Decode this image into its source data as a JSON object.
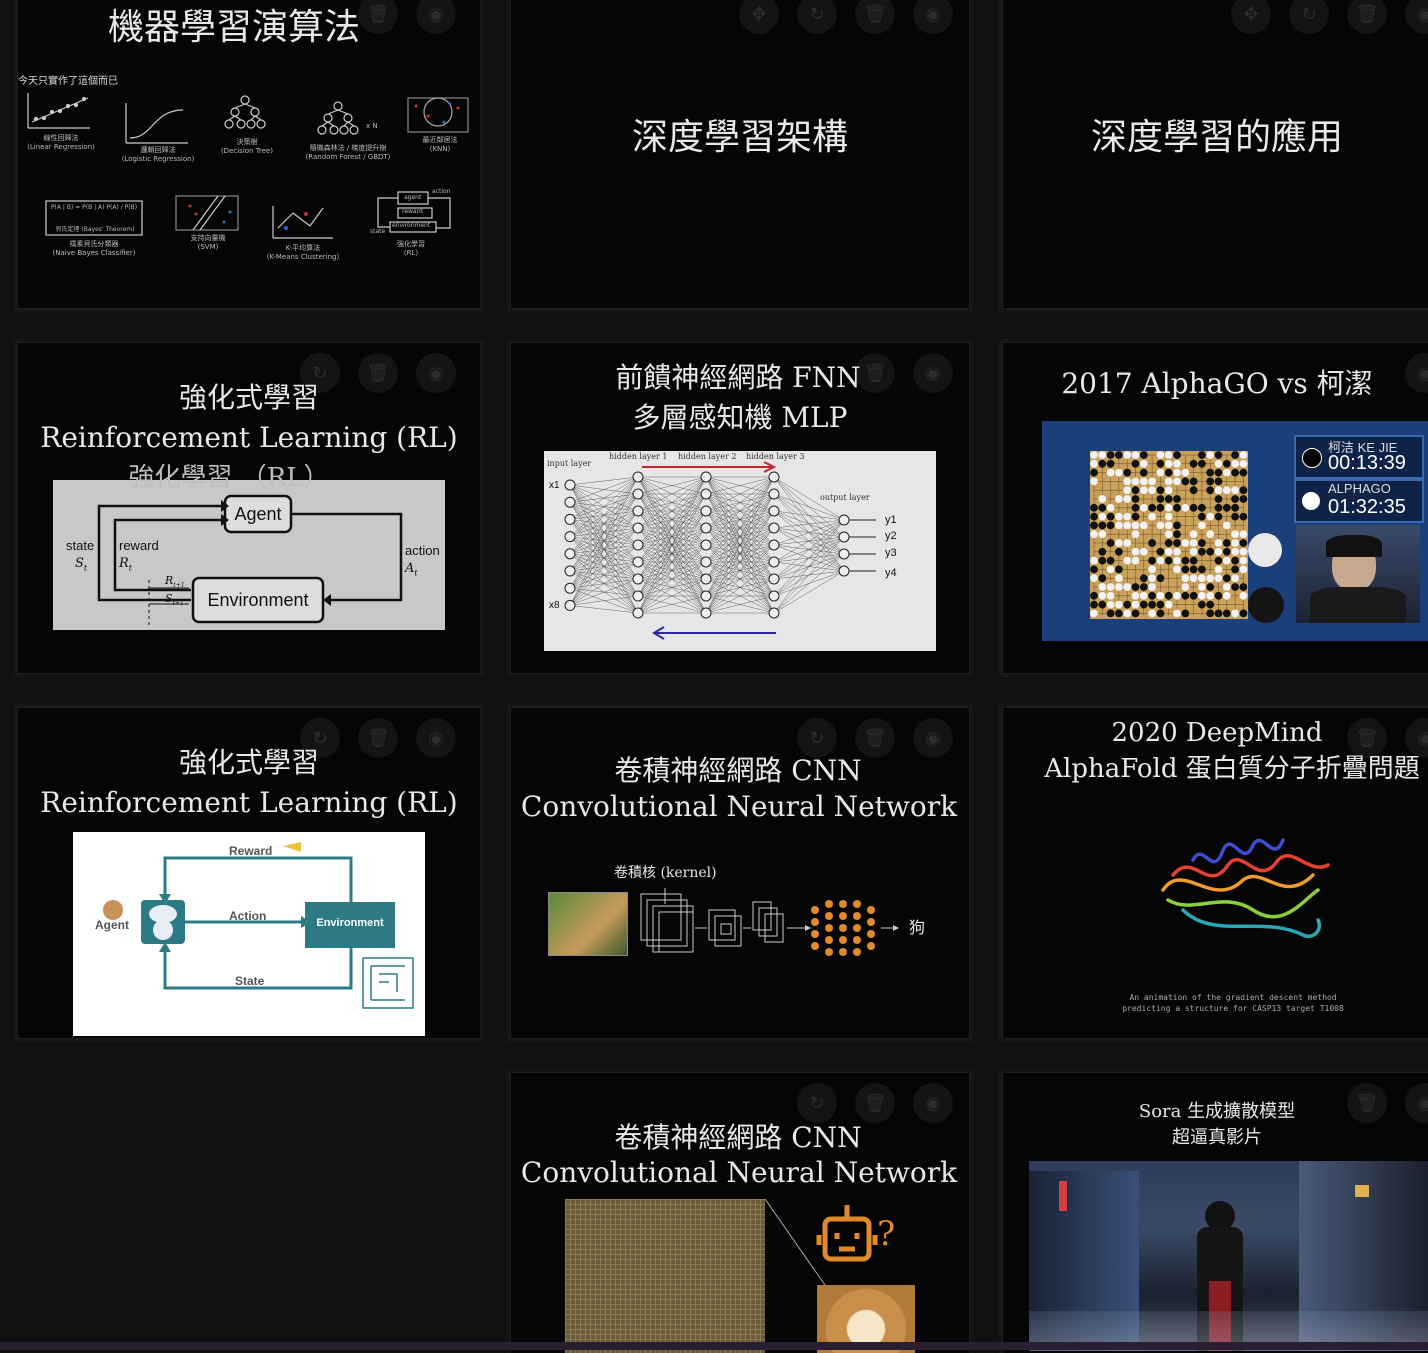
{
  "slides": [
    {
      "title": "機器學習演算法",
      "subtitle": "今天只實作了這個而已",
      "algos": [
        {
          "zh": "線性回歸法",
          "en": "(Linear Regression)"
        },
        {
          "zh": "邏輯回歸法",
          "en": "(Logistic Regression)"
        },
        {
          "zh": "決策樹",
          "en": "(Decision Tree)"
        },
        {
          "zh": "隨機森林法 / 梯度提升樹",
          "en": "(Random Forest / GBDT)"
        },
        {
          "zh": "最近鄰居法",
          "en": "(KNN)"
        },
        {
          "zh": "樸素貝氏分類器",
          "en": "(Naive Bayes Classifier)"
        },
        {
          "zh": "支持向量機",
          "en": "(SVM)"
        },
        {
          "zh": "K-平均算法",
          "en": "(K-Means Clustering)"
        },
        {
          "zh": "強化學習",
          "en": "(RL)"
        }
      ],
      "bayes": "P(A | B) = P(B | A) P(A) / P(B)",
      "bayes_label": "貝氏定理 (Bayes' Theorem)",
      "xn": "x N",
      "rl_labels": {
        "agent": "agent",
        "reward": "reward",
        "environment": "environment",
        "state": "state",
        "action": "action"
      }
    },
    {
      "title": "深度學習架構"
    },
    {
      "title": "深度學習的應用"
    },
    {
      "line1": "強化式學習",
      "line2": "Reinforcement Learning (RL)",
      "overlay": "強化學習 （RL）",
      "diagram": {
        "agent": "Agent",
        "environment": "Environment",
        "state": "state",
        "state_sym": "S",
        "reward": "reward",
        "reward_sym": "R",
        "action": "action",
        "action_sym": "A",
        "r_next": "R",
        "s_next": "S",
        "t": "t",
        "t1": "t+1"
      }
    },
    {
      "line1": "前饋神經網路 FNN",
      "line2": "多層感知機 MLP",
      "nn": {
        "input": "input layer",
        "h1": "hidden layer 1",
        "h2": "hidden layer 2",
        "h3": "hidden layer 3",
        "output": "output layer",
        "x1": "x1",
        "x8": "x8",
        "y": [
          "y1",
          "y2",
          "y3",
          "y4"
        ]
      }
    },
    {
      "title": "2017 AlphaGO vs 柯潔",
      "players": [
        {
          "name": "柯洁 KE JIE",
          "time": "00:13:39"
        },
        {
          "name": "ALPHAGO",
          "time": "01:32:35"
        }
      ]
    },
    {
      "line1": "強化式學習",
      "line2": "Reinforcement Learning (RL)",
      "diagram": {
        "reward": "Reward",
        "action": "Action",
        "state": "State",
        "agent": "Agent",
        "environment": "Environment"
      }
    },
    {
      "line1": "卷積神經網路 CNN",
      "line2": "Convolutional Neural Network",
      "kernel": "卷積核 (kernel)",
      "result": "狗"
    },
    {
      "line1": "2020 DeepMind",
      "line2": "AlphaFold 蛋白質分子折疊問題",
      "caption1": "An animation of the gradient descent method",
      "caption2": "predicting a structure for CASP13 target T1008"
    },
    {
      "line1": "卷積神經網路 CNN",
      "line2": "Convolutional Neural Network"
    },
    {
      "line1": "Sora 生成擴散模型",
      "line2": "超逼真影片"
    }
  ],
  "toolbar_icons": [
    "move-icon",
    "rotate-icon",
    "trash-icon",
    "eye-icon"
  ]
}
